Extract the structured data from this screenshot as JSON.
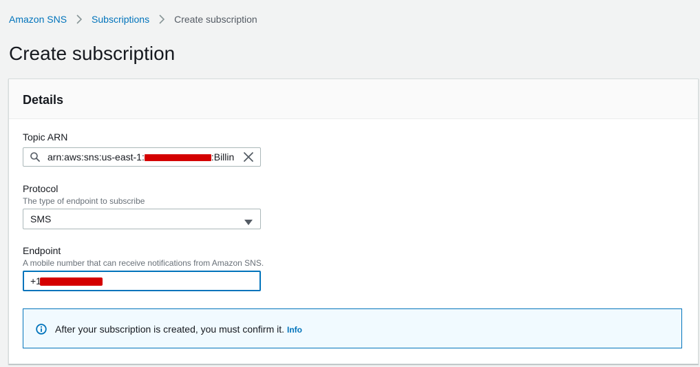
{
  "breadcrumb": {
    "items": [
      {
        "label": "Amazon SNS"
      },
      {
        "label": "Subscriptions"
      },
      {
        "label": "Create subscription"
      }
    ]
  },
  "page": {
    "title": "Create subscription"
  },
  "details": {
    "title": "Details",
    "topic_arn": {
      "label": "Topic ARN",
      "value_prefix": "arn:aws:sns:us-east-1:",
      "value_suffix": ":Billin",
      "icon": "search-icon",
      "clear_icon": "close-icon"
    },
    "protocol": {
      "label": "Protocol",
      "description": "The type of endpoint to subscribe",
      "selected": "SMS",
      "icon": "caret-down-icon"
    },
    "endpoint": {
      "label": "Endpoint",
      "description": "A mobile number that can receive notifications from Amazon SNS.",
      "value_prefix": "+1"
    },
    "alert": {
      "text": "After your subscription is created, you must confirm it.",
      "link": "Info",
      "icon": "info-icon"
    }
  },
  "colors": {
    "link": "#0073bb",
    "background": "#f2f3f3",
    "redaction": "#d40000"
  }
}
